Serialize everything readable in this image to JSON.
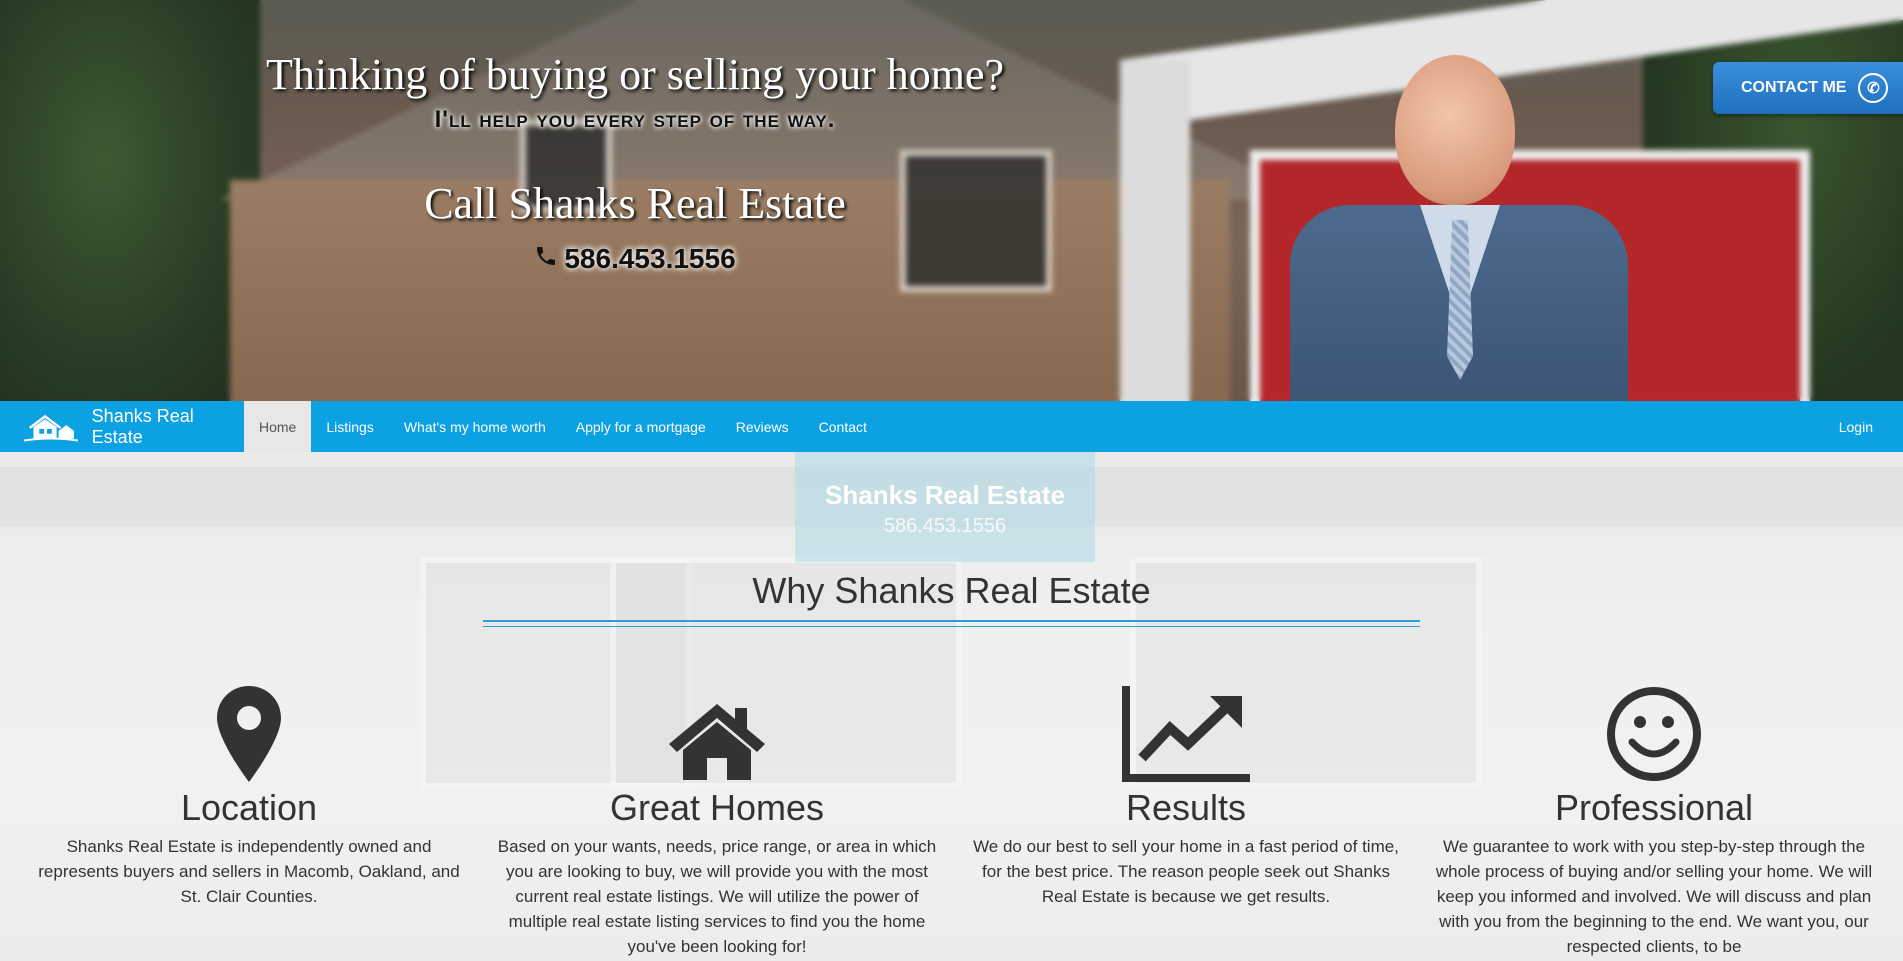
{
  "hero": {
    "headline": "Thinking of buying or selling your home?",
    "subheadline": "I'll help you every step of the way.",
    "call_line": "Call Shanks Real Estate",
    "phone": "586.453.1556",
    "contact_button": "CONTACT ME"
  },
  "nav": {
    "brand": "Shanks Real Estate",
    "items": [
      {
        "label": "Home",
        "active": true
      },
      {
        "label": "Listings"
      },
      {
        "label": "What's my home worth"
      },
      {
        "label": "Apply for a mortgage"
      },
      {
        "label": "Reviews"
      },
      {
        "label": "Contact"
      }
    ],
    "login": "Login"
  },
  "watermark": {
    "title": "Shanks Real Estate",
    "phone": "586.453.1556"
  },
  "main": {
    "section_title": "Why Shanks Real Estate",
    "features": [
      {
        "icon": "map-marker-icon",
        "title": "Location",
        "text": "Shanks Real Estate is independently owned and represents buyers and sellers in Macomb, Oakland, and St. Clair Counties."
      },
      {
        "icon": "home-icon",
        "title": "Great Homes",
        "text": "Based on your wants, needs, price range, or area in which you are looking to buy, we will provide you with the most current real estate listings. We will utilize the power of multiple real estate listing services to find you the home you've been looking for!"
      },
      {
        "icon": "line-chart-icon",
        "title": "Results",
        "text": "We do our best to sell your home in a fast period of time, for the best price. The reason people seek out Shanks Real Estate is because we get results."
      },
      {
        "icon": "smile-icon",
        "title": "Professional",
        "text": "We guarantee to work with you step-by-step through the whole process of buying and/or selling your home. We will keep you informed and involved. We will discuss and plan with you from the beginning to the end. We want you, our respected clients, to be"
      }
    ]
  },
  "colors": {
    "nav_bg": "#0ba1e2",
    "accent_rule": "#2a9fd8",
    "contact_button": "#2a7fd0",
    "text_dark": "#333333"
  }
}
